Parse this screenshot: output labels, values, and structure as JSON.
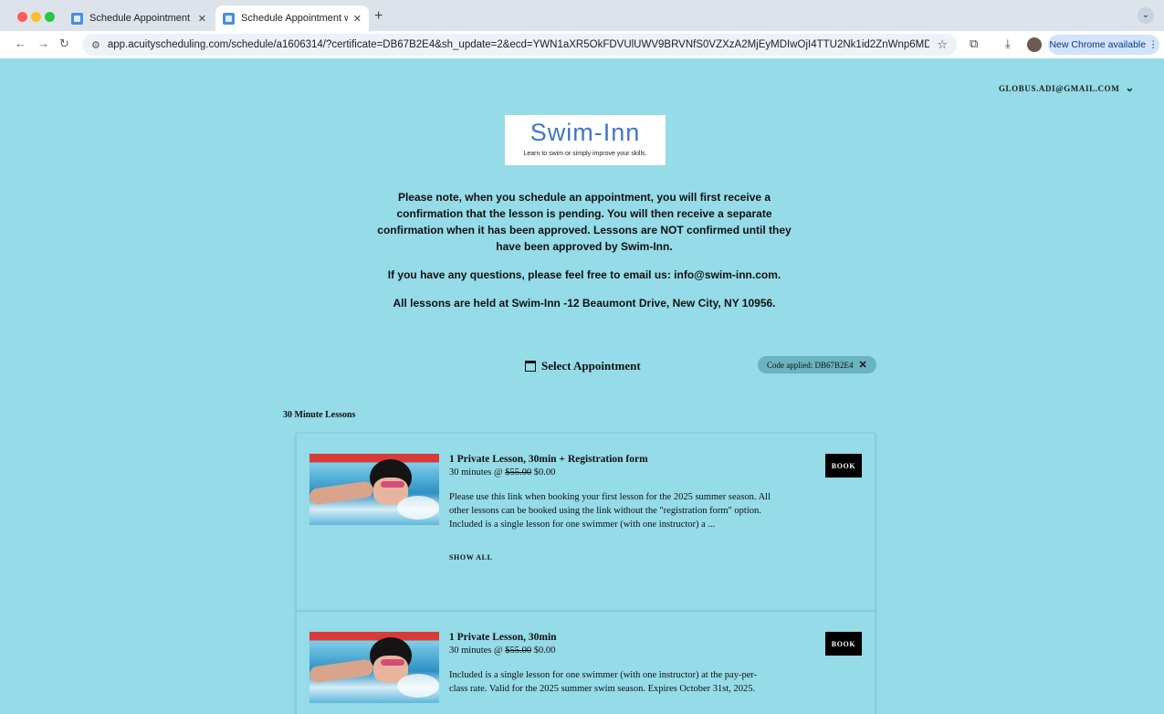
{
  "browser": {
    "tabs": [
      {
        "title": "Schedule Appointment with S",
        "active": false
      },
      {
        "title": "Schedule Appointment with S",
        "active": true
      }
    ],
    "new_tab": "+",
    "url": "app.acuityscheduling.com/schedule/a1606314/?certificate=DB67B2E4&sh_update=2&ecd=YWN1aXR5OkFDVUlUWV9BRVNfS0VZXzA2MjEyMDIwOjI4TTU2Nk1id2ZnWnp6MDdmTmxZS3NLUG...",
    "update_button": "New Chrome available"
  },
  "user": {
    "email": "GLOBUS.ADI@GMAIL.COM"
  },
  "logo": {
    "name": "Swim-Inn",
    "tagline": "Learn to swim or simply improve your skills."
  },
  "notice": {
    "p1": "Please note, when you schedule an appointment, you will first receive a confirmation that the lesson is pending. You will then receive a separate confirmation when it has been approved. Lessons are NOT confirmed until they have been approved by Swim-Inn.",
    "p2": "If you have any questions, please feel free to email us: info@swim-inn.com.",
    "p3": "All lessons are held at Swim-Inn -12 Beaumont Drive, New City, NY 10956."
  },
  "select": {
    "label": "Select Appointment",
    "code_chip": "Code applied: DB67B2E4"
  },
  "section": {
    "title": "30 Minute Lessons"
  },
  "lessons": [
    {
      "title": "1 Private Lesson, 30min + Registration form",
      "duration": "30 minutes @",
      "old_price": "$55.00",
      "price": "$0.00",
      "description": "Please use this link when booking your first lesson for the 2025 summer season. All other lessons can be booked using the link without the \"registration form\" option. Included is a single lesson for one swimmer (with one instructor) a ...",
      "show_all": "SHOW ALL",
      "book": "BOOK"
    },
    {
      "title": "1 Private Lesson, 30min",
      "duration": "30 minutes @",
      "old_price": "$55.00",
      "price": "$0.00",
      "description": "Included is a single lesson for one swimmer (with one instructor) at the pay-per-class rate. Valid for the 2025 summer swim season. Expires October 31st, 2025.",
      "book": "BOOK"
    }
  ]
}
